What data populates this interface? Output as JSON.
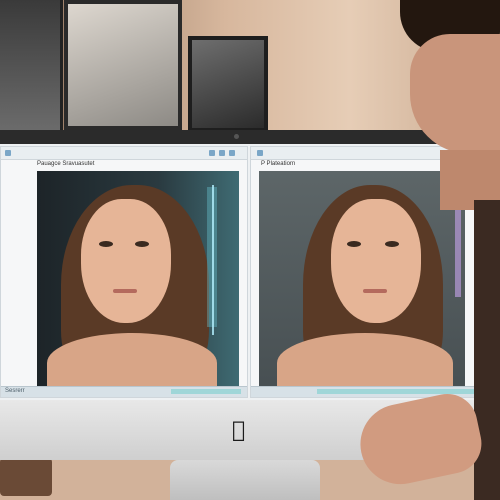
{
  "left_app": {
    "title": "Pauagce Sravuasutet",
    "status": "Sesrerr"
  },
  "right_app": {
    "title": "P Plateatiorn"
  },
  "icons": {
    "camera": "camera-icon",
    "apple": "apple-logo-icon"
  },
  "colors": {
    "accent": "#6fd0e0",
    "wall": "#d7b79d"
  }
}
